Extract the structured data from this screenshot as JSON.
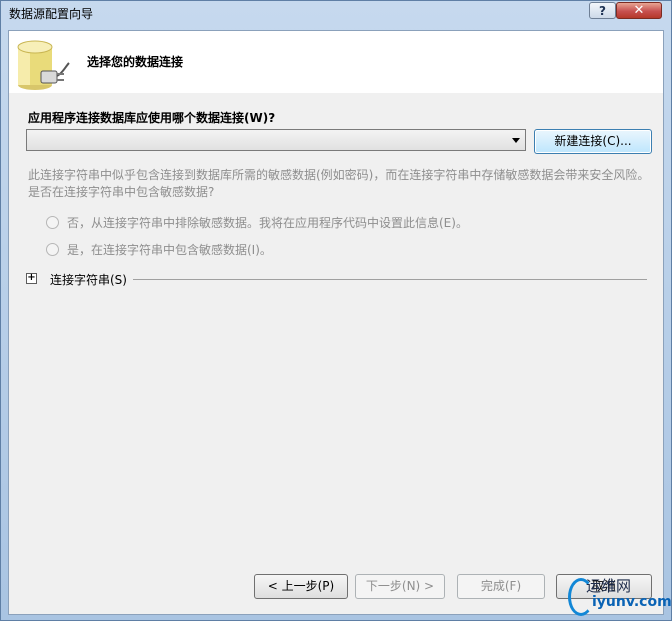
{
  "window": {
    "title": "数据源配置向导",
    "help_label": "?",
    "close_label": "✕"
  },
  "header": {
    "title": "选择您的数据连接",
    "icon": "database-plug-icon"
  },
  "question": "应用程序连接数据库应使用哪个数据连接(W)?",
  "connection_select": {
    "value": ""
  },
  "new_connection_label": "新建连接(C)...",
  "warning_text": "此连接字符串中似乎包含连接到数据库所需的敏感数据(例如密码)，而在连接字符串中存储敏感数据会带来安全风险。是否在连接字符串中包含敏感数据?",
  "options": {
    "no_label": "否，从连接字符串中排除敏感数据。我将在应用程序代码中设置此信息(E)。",
    "yes_label": "是，在连接字符串中包含敏感数据(I)。"
  },
  "connection_string": {
    "expander": "+",
    "label": "连接字符串(S)"
  },
  "footer": {
    "back": "< 上一步(P)",
    "next": "下一步(N) >",
    "finish": "完成(F)",
    "cancel": "取消"
  },
  "watermark": {
    "line1": "运维网",
    "line2": "iyunv.com"
  },
  "colors": {
    "title_bar": "#b9d1ea",
    "close_button": "#c75050",
    "disabled_text": "#8e8e8e",
    "watermark_blue": "#0a63b5"
  }
}
